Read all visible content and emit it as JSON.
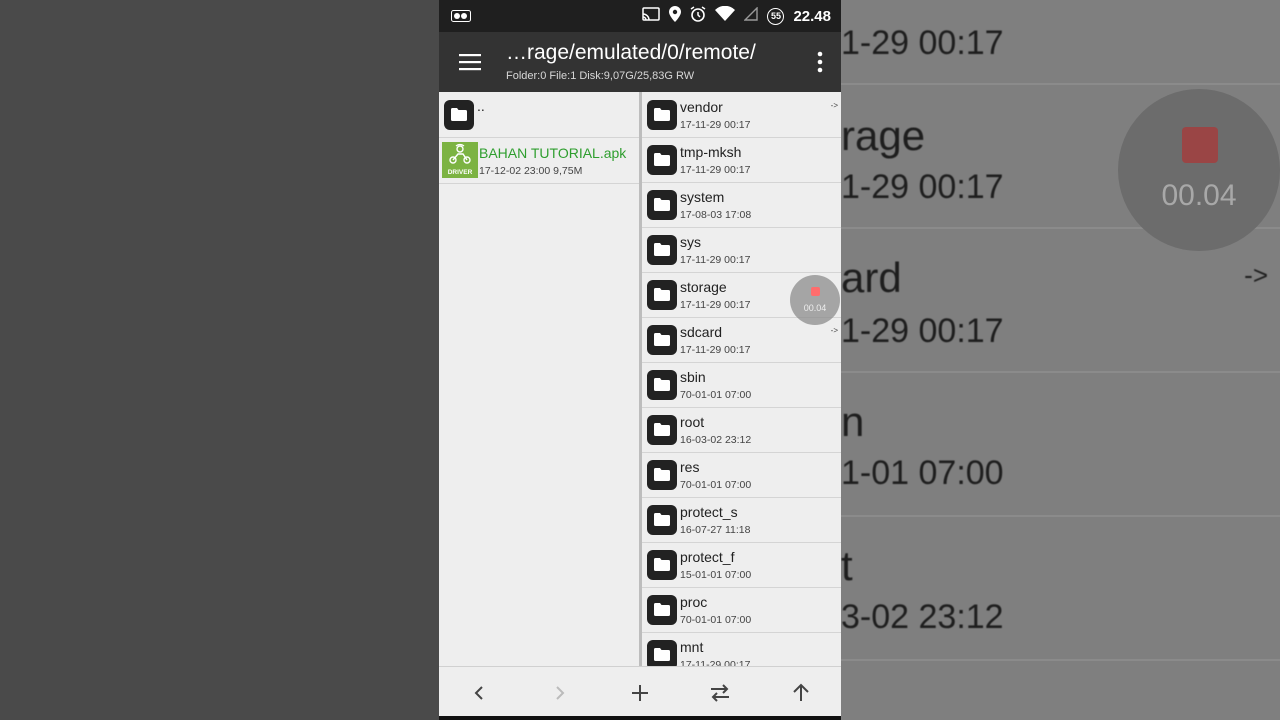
{
  "statusbar": {
    "time": "22.48",
    "badge": "55"
  },
  "toolbar": {
    "title": "…rage/emulated/0/remote/",
    "subtitle": "Folder:0 File:1  Disk:9,07G/25,83G  RW"
  },
  "left_pane": {
    "parent_label": "..",
    "file": {
      "name": "BAHAN TUTORIAL.apk",
      "meta": "17-12-02 23:00  9,75M",
      "icon_text": "DRIVER"
    }
  },
  "right_pane": {
    "items": [
      {
        "name": "vendor",
        "date": "17-11-29 00:17",
        "link": "->"
      },
      {
        "name": "tmp-mksh",
        "date": "17-11-29 00:17",
        "link": ""
      },
      {
        "name": "system",
        "date": "17-08-03 17:08",
        "link": ""
      },
      {
        "name": "sys",
        "date": "17-11-29 00:17",
        "link": ""
      },
      {
        "name": "storage",
        "date": "17-11-29 00:17",
        "link": ""
      },
      {
        "name": "sdcard",
        "date": "17-11-29 00:17",
        "link": "->"
      },
      {
        "name": "sbin",
        "date": "70-01-01 07:00",
        "link": ""
      },
      {
        "name": "root",
        "date": "16-03-02 23:12",
        "link": ""
      },
      {
        "name": "res",
        "date": "70-01-01 07:00",
        "link": ""
      },
      {
        "name": "protect_s",
        "date": "16-07-27 11:18",
        "link": ""
      },
      {
        "name": "protect_f",
        "date": "15-01-01 07:00",
        "link": ""
      },
      {
        "name": "proc",
        "date": "70-01-01 07:00",
        "link": ""
      },
      {
        "name": "mnt",
        "date": "17-11-29 00:17",
        "link": ""
      }
    ]
  },
  "recorder": {
    "time": "00.04"
  },
  "background": {
    "rows": [
      {
        "title": "",
        "date": "1-29 00:17",
        "arrow": ""
      },
      {
        "title": "rage",
        "date": "1-29 00:17",
        "arrow": ""
      },
      {
        "title": "ard",
        "date": "1-29 00:17",
        "arrow": "->"
      },
      {
        "title": "n",
        "date": "1-01 07:00",
        "arrow": ""
      },
      {
        "title": "t",
        "date": "3-02 23:12",
        "arrow": ""
      }
    ]
  }
}
